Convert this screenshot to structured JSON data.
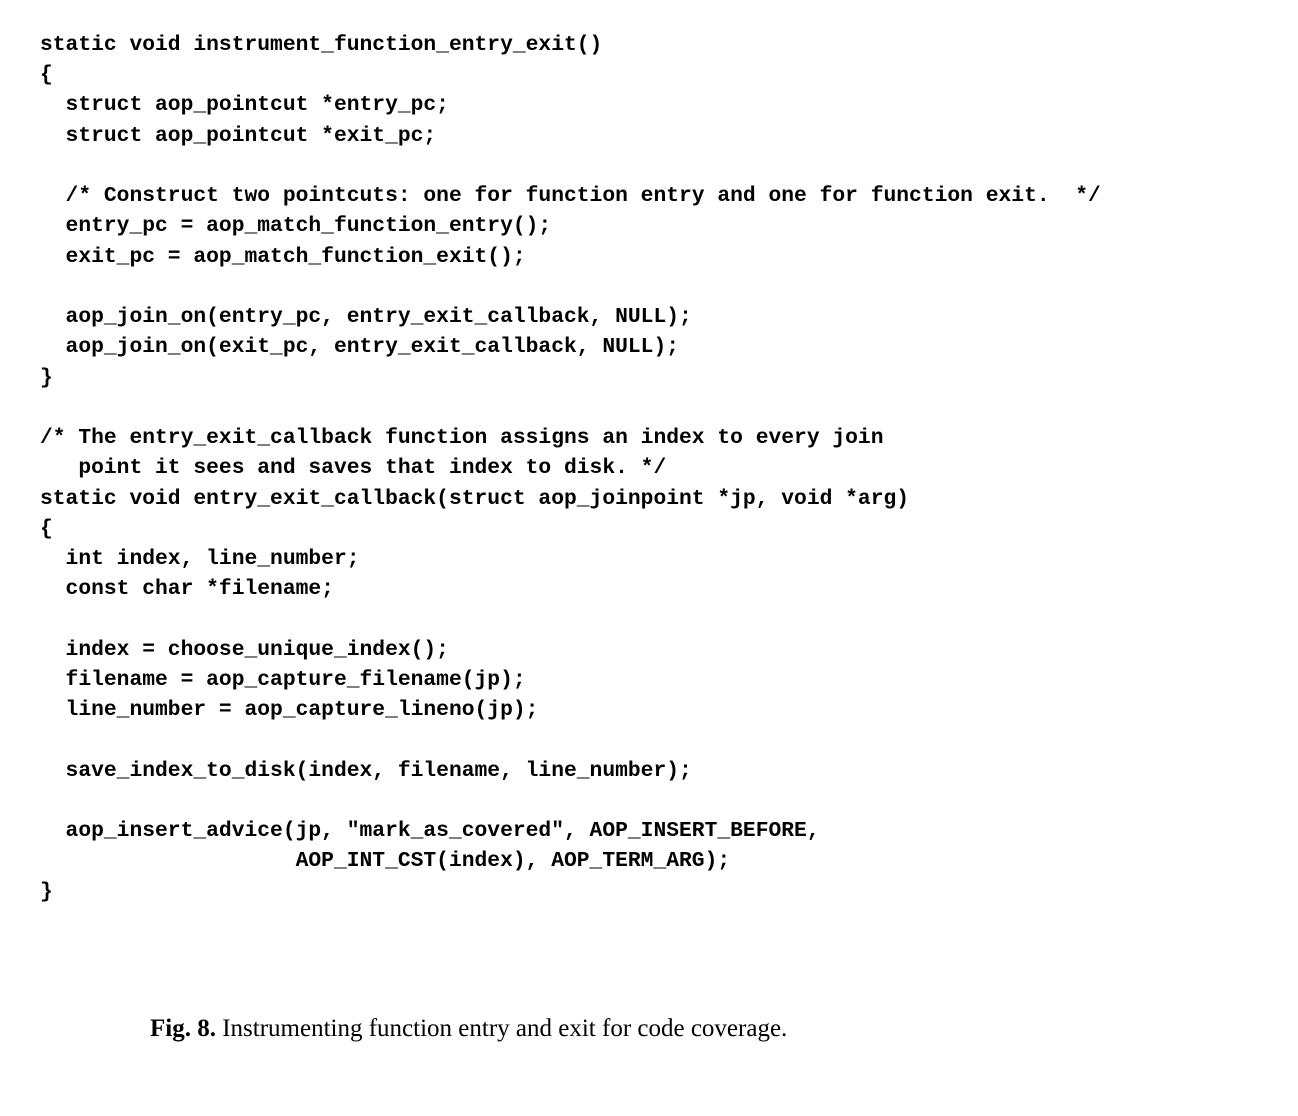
{
  "code": {
    "lines": [
      "static void instrument_function_entry_exit()",
      "{",
      "  struct aop_pointcut *entry_pc;",
      "  struct aop_pointcut *exit_pc;",
      "",
      "  /* Construct two pointcuts: one for function entry and one for function exit.  */",
      "  entry_pc = aop_match_function_entry();",
      "  exit_pc = aop_match_function_exit();",
      "",
      "  aop_join_on(entry_pc, entry_exit_callback, NULL);",
      "  aop_join_on(exit_pc, entry_exit_callback, NULL);",
      "}",
      "",
      "/* The entry_exit_callback function assigns an index to every join",
      "   point it sees and saves that index to disk. */",
      "static void entry_exit_callback(struct aop_joinpoint *jp, void *arg)",
      "{",
      "  int index, line_number;",
      "  const char *filename;",
      "",
      "  index = choose_unique_index();",
      "  filename = aop_capture_filename(jp);",
      "  line_number = aop_capture_lineno(jp);",
      "",
      "  save_index_to_disk(index, filename, line_number);",
      "",
      "  aop_insert_advice(jp, \"mark_as_covered\", AOP_INSERT_BEFORE,",
      "                    AOP_INT_CST(index), AOP_TERM_ARG);",
      "}"
    ]
  },
  "caption": {
    "label": "Fig. 8.",
    "text": " Instrumenting function entry and exit for code coverage."
  }
}
